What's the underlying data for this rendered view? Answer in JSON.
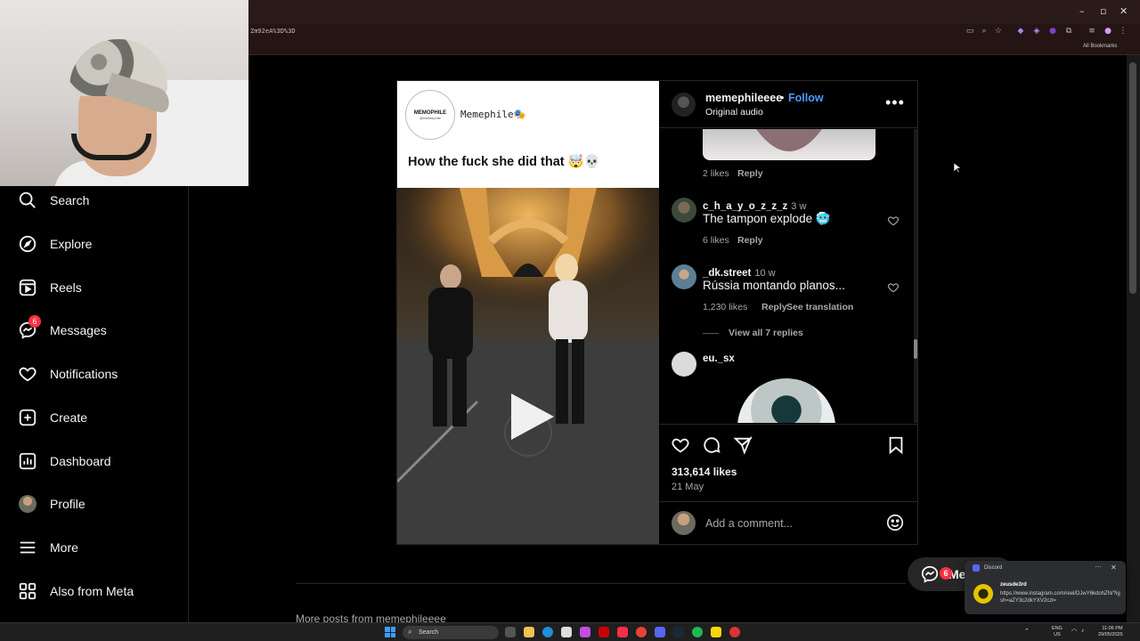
{
  "browser": {
    "url": "Zm92eA%3D%3D",
    "all_bookmarks": "All Bookmarks"
  },
  "sidebar": {
    "items": [
      {
        "label": "Search",
        "icon": "search-icon"
      },
      {
        "label": "Explore",
        "icon": "compass-icon"
      },
      {
        "label": "Reels",
        "icon": "reels-icon"
      },
      {
        "label": "Messages",
        "icon": "messenger-icon",
        "badge": "6"
      },
      {
        "label": "Notifications",
        "icon": "heart-icon"
      },
      {
        "label": "Create",
        "icon": "plus-square-icon"
      },
      {
        "label": "Dashboard",
        "icon": "dashboard-icon"
      },
      {
        "label": "Profile",
        "icon": "profile-avatar"
      },
      {
        "label": "More",
        "icon": "menu-icon"
      },
      {
        "label": "Also from Meta",
        "icon": "meta-icon"
      }
    ]
  },
  "post": {
    "meme": {
      "logo_text": "MEMOPHILE",
      "logo_handle": "@Memephile",
      "name": "Memephile🎭",
      "caption": "How the fuck she did that 🤯💀"
    },
    "author": "memephileeee",
    "dot": "•",
    "follow_label": "Follow",
    "audio": "Original audio",
    "comments": [
      {
        "likes": "2 likes",
        "reply": "Reply"
      },
      {
        "user": "c_h_a_y_o_z_z_z",
        "time": "3 w",
        "text": "The tampon explode 🥶",
        "likes": "6 likes",
        "reply": "Reply"
      },
      {
        "user": "_dk.street",
        "time": "10 w",
        "text": "Rússia montando planos...",
        "likes": "1,230 likes",
        "reply": "Reply",
        "translate": "See translation",
        "view_replies": "View all 7 replies"
      },
      {
        "user": "eu._sx"
      }
    ],
    "likes": "313,614 likes",
    "date": "21 May",
    "add_comment_placeholder": "Add a comment..."
  },
  "below": {
    "more_from": "More posts from memephileeee"
  },
  "messages_pill": {
    "label": "Messages",
    "badge": "6"
  },
  "discord_toast": {
    "app": "Discord",
    "user": "zeusde3rd",
    "message": "https://www.instagram.com/reel/DJwY6kdohZN/?igsh=aZY3c2dkYXV2czl="
  },
  "taskbar": {
    "search": "Search",
    "lang": "ENG",
    "region": "US",
    "time": "11:06 PM",
    "date": "29/05/2025"
  },
  "colors": {
    "accent": "#4a9bff",
    "badge": "#ff3040",
    "text_secondary": "#a8a8a8"
  }
}
